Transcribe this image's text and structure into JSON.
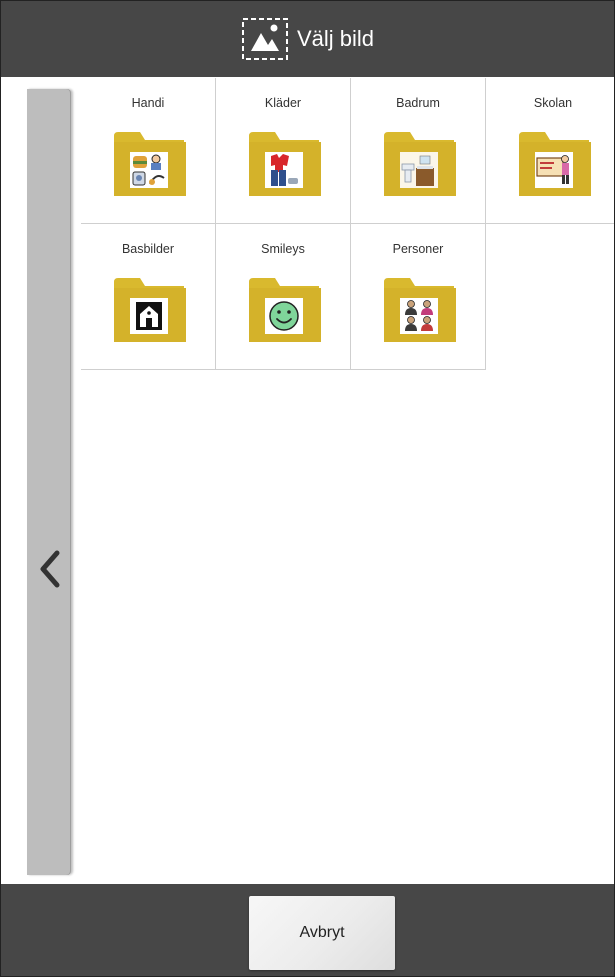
{
  "header": {
    "title": "Välj bild",
    "icon": "image-select-icon"
  },
  "side_panel": {
    "icon": "chevron-left-icon"
  },
  "folders": [
    {
      "label": "Handi"
    },
    {
      "label": "Kläder"
    },
    {
      "label": "Badrum"
    },
    {
      "label": "Skolan"
    },
    {
      "label": "Basbilder"
    },
    {
      "label": "Smileys"
    },
    {
      "label": "Personer"
    }
  ],
  "footer": {
    "cancel_label": "Avbryt"
  },
  "colors": {
    "bar": "#474747",
    "folder": "#d9b92e",
    "folder_dark": "#c9a722",
    "side_panel": "#bdbdbd"
  }
}
